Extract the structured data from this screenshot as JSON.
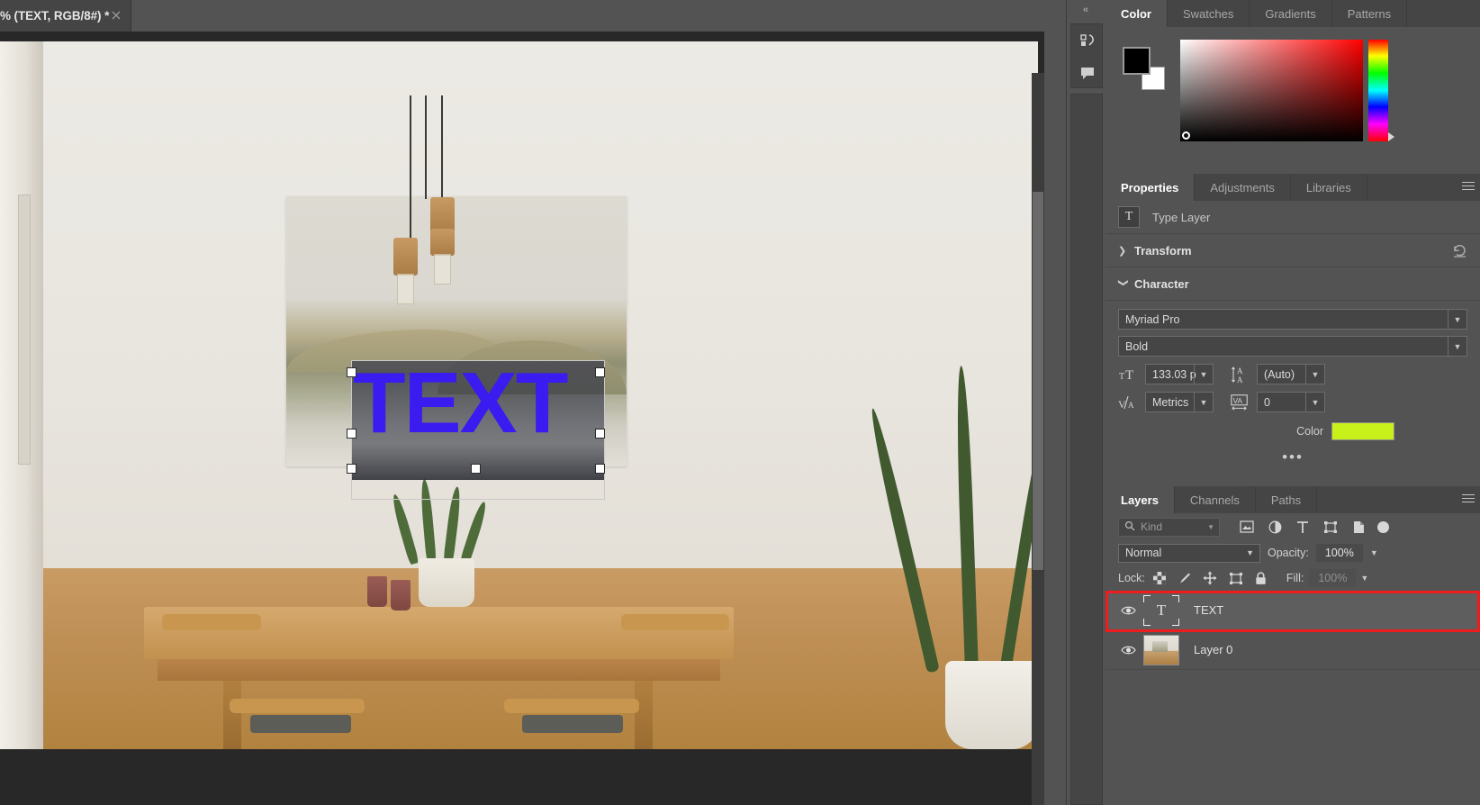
{
  "document_tab": {
    "title": "% (TEXT, RGB/8#) *",
    "close_icon": "close-icon"
  },
  "canvas": {
    "text_layer_content": "TEXT",
    "text_color": "#3a1bf0"
  },
  "rail": {
    "collapse_label": "«",
    "icons": [
      "history-icon",
      "comments-icon"
    ]
  },
  "color_panel": {
    "tabs": [
      {
        "label": "Color",
        "active": true
      },
      {
        "label": "Swatches",
        "active": false
      },
      {
        "label": "Gradients",
        "active": false
      },
      {
        "label": "Patterns",
        "active": false
      }
    ],
    "foreground_color": "#000000",
    "background_color": "#ffffff",
    "menu_icon": "panel-menu-icon"
  },
  "properties_panel": {
    "tabs": [
      {
        "label": "Properties",
        "active": true
      },
      {
        "label": "Adjustments",
        "active": false
      },
      {
        "label": "Libraries",
        "active": false
      }
    ],
    "layer_type": "Type Layer",
    "type_icon": "type-layer-icon",
    "transform": {
      "title": "Transform",
      "collapsed": true,
      "reset_icon": "reset-icon"
    },
    "character": {
      "title": "Character",
      "collapsed": false,
      "font_family": "Myriad Pro",
      "font_style": "Bold",
      "font_size": "133.03 p",
      "leading": "(Auto)",
      "kerning": "Metrics",
      "tracking": "0",
      "color_label": "Color",
      "color_value": "#c8f01a",
      "more_options": "•••",
      "size_icon": "font-size-icon",
      "leading_icon": "leading-icon",
      "kerning_icon": "kerning-icon",
      "tracking_icon": "tracking-icon"
    }
  },
  "layers_panel": {
    "tabs": [
      {
        "label": "Layers",
        "active": true
      },
      {
        "label": "Channels",
        "active": false
      },
      {
        "label": "Paths",
        "active": false
      }
    ],
    "filter": {
      "placeholder": "Kind",
      "search_icon": "search-icon",
      "icons": [
        "pixel-filter-icon",
        "adjustment-filter-icon",
        "type-filter-icon",
        "shape-filter-icon",
        "smart-object-filter-icon"
      ],
      "toggle_icon": "filter-toggle-icon"
    },
    "blend_mode": "Normal",
    "opacity_label": "Opacity:",
    "opacity_value": "100%",
    "lock_label": "Lock:",
    "lock_icons": [
      "lock-transparency-icon",
      "lock-image-icon",
      "lock-position-icon",
      "lock-artboard-icon",
      "lock-all-icon"
    ],
    "fill_label": "Fill:",
    "fill_value": "100%",
    "layers": [
      {
        "name": "TEXT",
        "visible": true,
        "selected": true,
        "kind": "type",
        "eye_icon": "eye-icon",
        "thumb_icon": "type-thumbnail-icon"
      },
      {
        "name": "Layer 0",
        "visible": true,
        "selected": false,
        "kind": "image",
        "eye_icon": "eye-icon",
        "thumb_icon": "image-thumbnail-icon"
      }
    ],
    "highlight_color": "#ee1c1c"
  }
}
